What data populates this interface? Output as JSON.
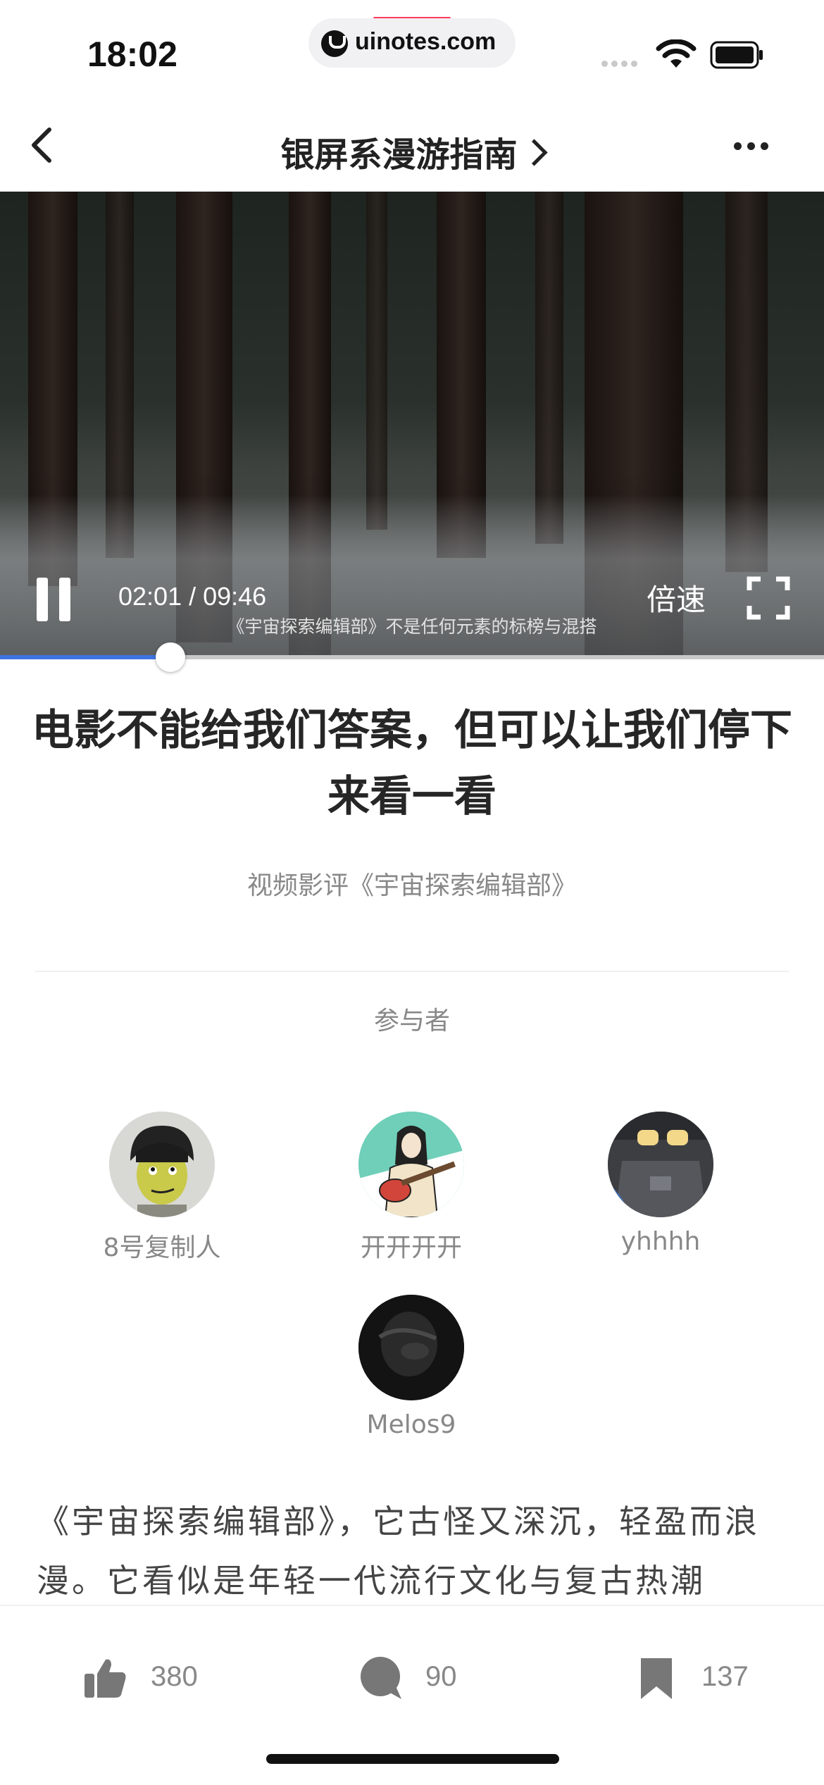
{
  "status_bar": {
    "time": "18:02",
    "url": "uinotes.com"
  },
  "nav": {
    "title": "银屏系漫游指南"
  },
  "video": {
    "current_time": "02:01",
    "duration": "09:46",
    "time_text": "02:01 / 09:46",
    "subtitle": "《宇宙探索编辑部》不是任何元素的标榜与混搭",
    "speed_label": "倍速",
    "progress_fraction": 0.207
  },
  "article": {
    "headline": "电影不能给我们答案，但可以让我们停下来看一看",
    "subhead": "视频影评《宇宙探索编辑部》",
    "participants_label": "参与者",
    "participants": [
      {
        "name": "8号复制人"
      },
      {
        "name": "开开开开"
      },
      {
        "name": "yhhhh"
      },
      {
        "name": "Melos9"
      }
    ],
    "body": "《宇宙探索编辑部》，它古怪又深沉，轻盈而浪漫。它看似是年轻一代流行文化与复古热潮"
  },
  "actions": {
    "likes": "380",
    "comments": "90",
    "bookmarks": "137"
  },
  "colors": {
    "accent": "#3f73e0",
    "text_primary": "#262626",
    "text_secondary": "#888888"
  }
}
